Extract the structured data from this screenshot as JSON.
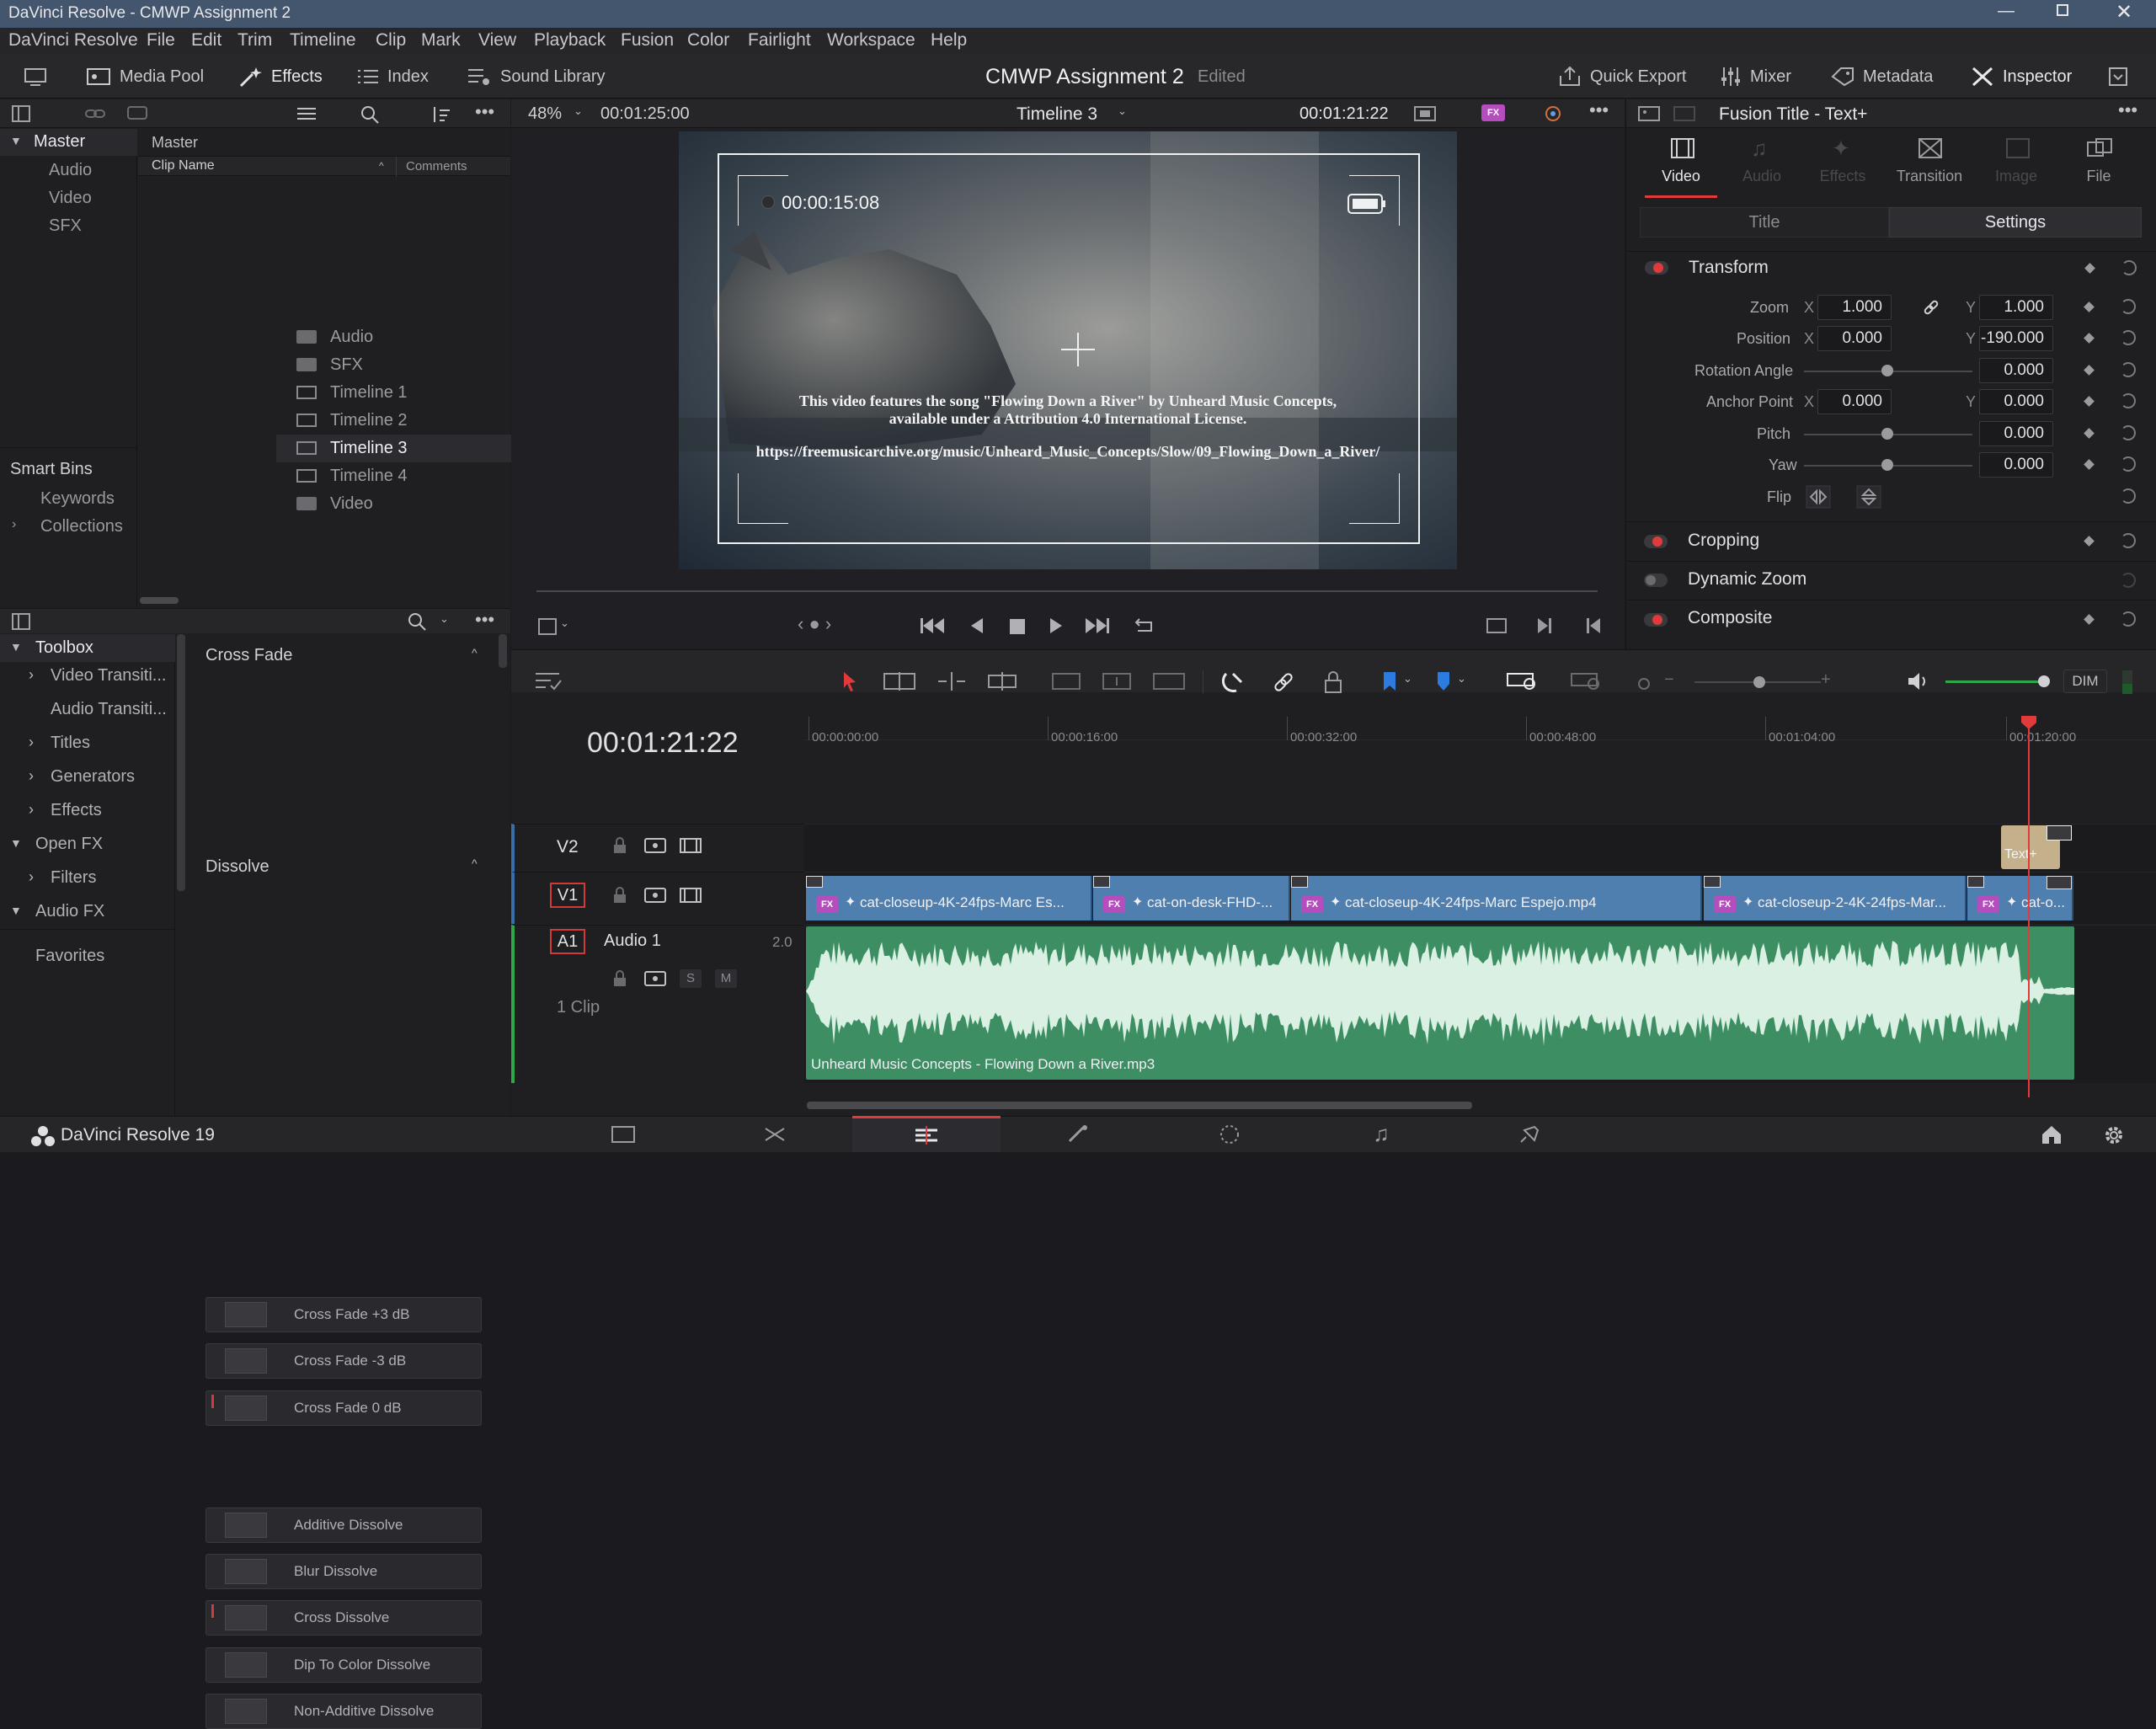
{
  "window": {
    "title": "DaVinci Resolve - CMWP Assignment 2"
  },
  "menu": [
    "DaVinci Resolve",
    "File",
    "Edit",
    "Trim",
    "Timeline",
    "Clip",
    "Mark",
    "View",
    "Playback",
    "Fusion",
    "Color",
    "Fairlight",
    "Workspace",
    "Help"
  ],
  "toolbar": {
    "media_pool": "Media Pool",
    "effects": "Effects",
    "index": "Index",
    "sound_library": "Sound Library",
    "project_name": "CMWP Assignment 2",
    "status": "Edited",
    "quick_export": "Quick Export",
    "mixer": "Mixer",
    "metadata": "Metadata",
    "inspector": "Inspector"
  },
  "media_pool": {
    "bins": [
      "Master",
      "Audio",
      "Video",
      "SFX"
    ],
    "smart_bins_title": "Smart Bins",
    "smart_bins": [
      "Keywords",
      "Collections"
    ],
    "breadcrumb": "Master",
    "col_clip_name": "Clip Name",
    "col_comments": "Comments",
    "clips": [
      {
        "name": "Audio",
        "type": "folder"
      },
      {
        "name": "SFX",
        "type": "folder"
      },
      {
        "name": "Timeline 1",
        "type": "timeline"
      },
      {
        "name": "Timeline 2",
        "type": "timeline"
      },
      {
        "name": "Timeline 3",
        "type": "timeline",
        "selected": true
      },
      {
        "name": "Timeline 4",
        "type": "timeline"
      },
      {
        "name": "Video",
        "type": "folder"
      }
    ]
  },
  "effects_panel": {
    "toolbox_title": "Toolbox",
    "tree": [
      "Video Transiti...",
      "Audio Transiti...",
      "Titles",
      "Generators",
      "Effects"
    ],
    "open_fx": "Open FX",
    "filters": "Filters",
    "audio_fx": "Audio FX",
    "favorites": "Favorites",
    "groups": [
      {
        "title": "Cross Fade",
        "items": [
          "Cross Fade +3 dB",
          "Cross Fade -3 dB",
          "Cross Fade 0 dB"
        ]
      },
      {
        "title": "Dissolve",
        "items": [
          "Additive Dissolve",
          "Blur Dissolve",
          "Cross Dissolve",
          "Dip To Color Dissolve",
          "Non-Additive Dissolve"
        ]
      }
    ]
  },
  "viewer": {
    "zoom": "48%",
    "source_tc": "00:01:25:00",
    "timeline_name": "Timeline 3",
    "record_tc": "00:01:21:22",
    "overlay_tc": "00:00:15:08",
    "credit_line1": "This video features the song \"Flowing Down a River\" by Unheard Music Concepts,",
    "credit_line2": "available under a Attribution 4.0 International License.",
    "credit_url": "https://freemusicarchive.org/music/Unheard_Music_Concepts/Slow/09_Flowing_Down_a_River/",
    "scrub_position": 0.96
  },
  "inspector": {
    "title": "Fusion Title - Text+",
    "tabs": [
      "Video",
      "Audio",
      "Effects",
      "Transition",
      "Image",
      "File"
    ],
    "subtabs": [
      "Title",
      "Settings"
    ],
    "sections": [
      "Transform",
      "Cropping",
      "Dynamic Zoom",
      "Composite"
    ],
    "zoom_label": "Zoom",
    "zoom_x": "1.000",
    "zoom_y": "1.000",
    "position_label": "Position",
    "position_x": "0.000",
    "position_y": "-190.000",
    "rotation_label": "Rotation Angle",
    "rotation": "0.000",
    "anchor_label": "Anchor Point",
    "anchor_x": "0.000",
    "anchor_y": "0.000",
    "pitch_label": "Pitch",
    "pitch": "0.000",
    "yaw_label": "Yaw",
    "yaw": "0.000",
    "flip_label": "Flip",
    "x": "X",
    "y": "Y"
  },
  "timeline": {
    "timecode": "00:01:21:22",
    "ruler": [
      "00:00:00:00",
      "00:00:16:00",
      "00:00:32:00",
      "00:00:48:00",
      "00:01:04:00",
      "00:01:20:00"
    ],
    "dim": "DIM",
    "tracks": {
      "v2": "V2",
      "v1": "V1",
      "a1": "A1",
      "audio_name": "Audio 1",
      "audio_level": "2.0",
      "clip_count": "1 Clip",
      "solo": "S",
      "mute": "M"
    },
    "fx_badge": "FX",
    "title_clip": "Text+",
    "video_clips": [
      "cat-closeup-4K-24fps-Marc Es...",
      "cat-on-desk-FHD-...",
      "cat-closeup-4K-24fps-Marc Espejo.mp4",
      "cat-closeup-2-4K-24fps-Mar...",
      "cat-o..."
    ],
    "audio_clip": "Unheard Music Concepts - Flowing Down a River.mp3"
  },
  "footer": {
    "app": "DaVinci Resolve 19"
  },
  "colors": {
    "accent_red": "#e03a3a",
    "video_clip": "#4f7fae",
    "audio_clip": "#3d8f63",
    "title_bar": "#44566d"
  }
}
